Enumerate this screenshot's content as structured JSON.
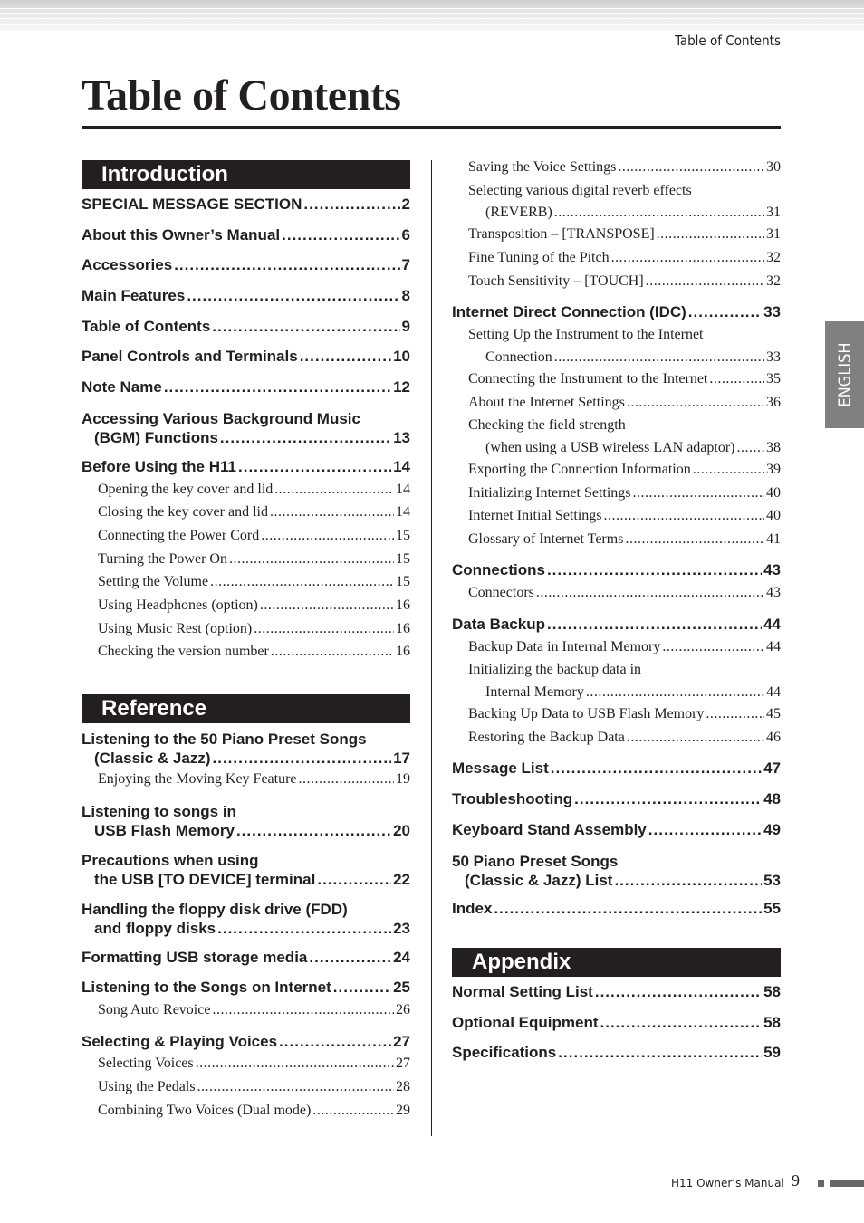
{
  "running_header": "Table of Contents",
  "title": "Table of Contents",
  "language_tab": "ENGLISH",
  "footer": {
    "manual": "H11 Owner’s Manual",
    "page": "9"
  },
  "left": [
    {
      "t": "header",
      "label": "Introduction"
    },
    {
      "t": "major",
      "lines": [
        "SPECIAL MESSAGE SECTION"
      ],
      "page": "2"
    },
    {
      "t": "major",
      "lines": [
        "About this Owner’s Manual"
      ],
      "page": "6"
    },
    {
      "t": "major",
      "lines": [
        "Accessories"
      ],
      "page": "7"
    },
    {
      "t": "major",
      "lines": [
        "Main Features"
      ],
      "page": "8"
    },
    {
      "t": "major",
      "lines": [
        "Table of Contents"
      ],
      "page": "9"
    },
    {
      "t": "major",
      "lines": [
        "Panel Controls and Terminals"
      ],
      "page": "10"
    },
    {
      "t": "major",
      "lines": [
        "Note Name"
      ],
      "page": "12"
    },
    {
      "t": "major",
      "lines": [
        "Accessing Various Background Music",
        "(BGM) Functions"
      ],
      "page": "13"
    },
    {
      "t": "major",
      "lines": [
        "Before Using the H11"
      ],
      "page": "14"
    },
    {
      "t": "minor",
      "lines": [
        "Opening the key cover and lid"
      ],
      "page": "14"
    },
    {
      "t": "minor",
      "lines": [
        "Closing the key cover and lid"
      ],
      "page": "14"
    },
    {
      "t": "minor",
      "lines": [
        "Connecting the Power Cord"
      ],
      "page": "15"
    },
    {
      "t": "minor",
      "lines": [
        "Turning the Power On"
      ],
      "page": "15"
    },
    {
      "t": "minor",
      "lines": [
        "Setting the Volume"
      ],
      "page": "15"
    },
    {
      "t": "minor",
      "lines": [
        "Using Headphones (option)"
      ],
      "page": "16"
    },
    {
      "t": "minor",
      "lines": [
        "Using Music Rest (option)"
      ],
      "page": "16"
    },
    {
      "t": "minor",
      "lines": [
        "Checking the version number"
      ],
      "page": "16"
    },
    {
      "t": "header",
      "label": "Reference",
      "gap": true
    },
    {
      "t": "major",
      "lines": [
        "Listening to the 50 Piano Preset Songs",
        "(Classic & Jazz)"
      ],
      "page": "17"
    },
    {
      "t": "minor",
      "lines": [
        "Enjoying the Moving Key Feature"
      ],
      "page": "19"
    },
    {
      "t": "major",
      "lines": [
        "Listening to songs in",
        "USB Flash Memory"
      ],
      "page": "20"
    },
    {
      "t": "major",
      "lines": [
        "Precautions when using",
        "the USB [TO DEVICE] terminal"
      ],
      "page": "22"
    },
    {
      "t": "major",
      "lines": [
        "Handling the floppy disk drive (FDD)",
        "and floppy disks"
      ],
      "page": "23"
    },
    {
      "t": "major",
      "lines": [
        "Formatting USB storage media"
      ],
      "page": "24"
    },
    {
      "t": "major",
      "lines": [
        "Listening to the Songs on Internet"
      ],
      "page": "25"
    },
    {
      "t": "minor",
      "lines": [
        "Song Auto Revoice"
      ],
      "page": "26"
    },
    {
      "t": "major",
      "lines": [
        "Selecting & Playing Voices"
      ],
      "page": "27"
    },
    {
      "t": "minor",
      "lines": [
        "Selecting Voices"
      ],
      "page": "27"
    },
    {
      "t": "minor",
      "lines": [
        "Using the Pedals"
      ],
      "page": "28"
    },
    {
      "t": "minor",
      "lines": [
        "Combining Two Voices (Dual mode)"
      ],
      "page": "29"
    }
  ],
  "right": [
    {
      "t": "minor",
      "lines": [
        "Saving the Voice Settings"
      ],
      "page": "30"
    },
    {
      "t": "minor",
      "lines": [
        "Selecting various digital reverb effects",
        "(REVERB)"
      ],
      "page": "31"
    },
    {
      "t": "minor",
      "lines": [
        "Transposition – [TRANSPOSE]"
      ],
      "page": "31"
    },
    {
      "t": "minor",
      "lines": [
        "Fine Tuning of the Pitch"
      ],
      "page": "32"
    },
    {
      "t": "minor",
      "lines": [
        "Touch Sensitivity – [TOUCH]"
      ],
      "page": "32"
    },
    {
      "t": "major",
      "lines": [
        "Internet Direct Connection (IDC)"
      ],
      "page": "33"
    },
    {
      "t": "minor",
      "lines": [
        "Setting Up the Instrument to the Internet",
        "Connection"
      ],
      "page": "33"
    },
    {
      "t": "minor",
      "lines": [
        "Connecting the Instrument to the Internet"
      ],
      "page": "35"
    },
    {
      "t": "minor",
      "lines": [
        "About the Internet Settings"
      ],
      "page": "36"
    },
    {
      "t": "minor",
      "lines": [
        "Checking the field strength",
        "(when using a USB wireless LAN adaptor)"
      ],
      "page": "38"
    },
    {
      "t": "minor",
      "lines": [
        "Exporting the Connection Information"
      ],
      "page": "39"
    },
    {
      "t": "minor",
      "lines": [
        "Initializing Internet Settings"
      ],
      "page": "40"
    },
    {
      "t": "minor",
      "lines": [
        "Internet Initial Settings"
      ],
      "page": "40"
    },
    {
      "t": "minor",
      "lines": [
        "Glossary of Internet Terms"
      ],
      "page": "41"
    },
    {
      "t": "major",
      "lines": [
        "Connections"
      ],
      "page": "43"
    },
    {
      "t": "minor",
      "lines": [
        "Connectors"
      ],
      "page": "43"
    },
    {
      "t": "major",
      "lines": [
        "Data Backup"
      ],
      "page": "44"
    },
    {
      "t": "minor",
      "lines": [
        "Backup Data in Internal Memory"
      ],
      "page": "44"
    },
    {
      "t": "minor",
      "lines": [
        "Initializing the backup data in",
        "Internal Memory"
      ],
      "page": "44"
    },
    {
      "t": "minor",
      "lines": [
        "Backing Up Data to USB Flash Memory"
      ],
      "page": "45"
    },
    {
      "t": "minor",
      "lines": [
        "Restoring the Backup Data"
      ],
      "page": "46"
    },
    {
      "t": "major",
      "lines": [
        "Message List"
      ],
      "page": "47"
    },
    {
      "t": "major",
      "lines": [
        "Troubleshooting"
      ],
      "page": "48"
    },
    {
      "t": "major",
      "lines": [
        "Keyboard Stand Assembly"
      ],
      "page": "49"
    },
    {
      "t": "major",
      "lines": [
        "50 Piano Preset Songs",
        "(Classic & Jazz) List"
      ],
      "page": "53"
    },
    {
      "t": "major",
      "lines": [
        "Index"
      ],
      "page": "55"
    },
    {
      "t": "header",
      "label": "Appendix",
      "gapapp": true
    },
    {
      "t": "major",
      "lines": [
        "Normal Setting List"
      ],
      "page": "58"
    },
    {
      "t": "major",
      "lines": [
        "Optional Equipment"
      ],
      "page": "58"
    },
    {
      "t": "major",
      "lines": [
        "Specifications"
      ],
      "page": "59"
    }
  ]
}
